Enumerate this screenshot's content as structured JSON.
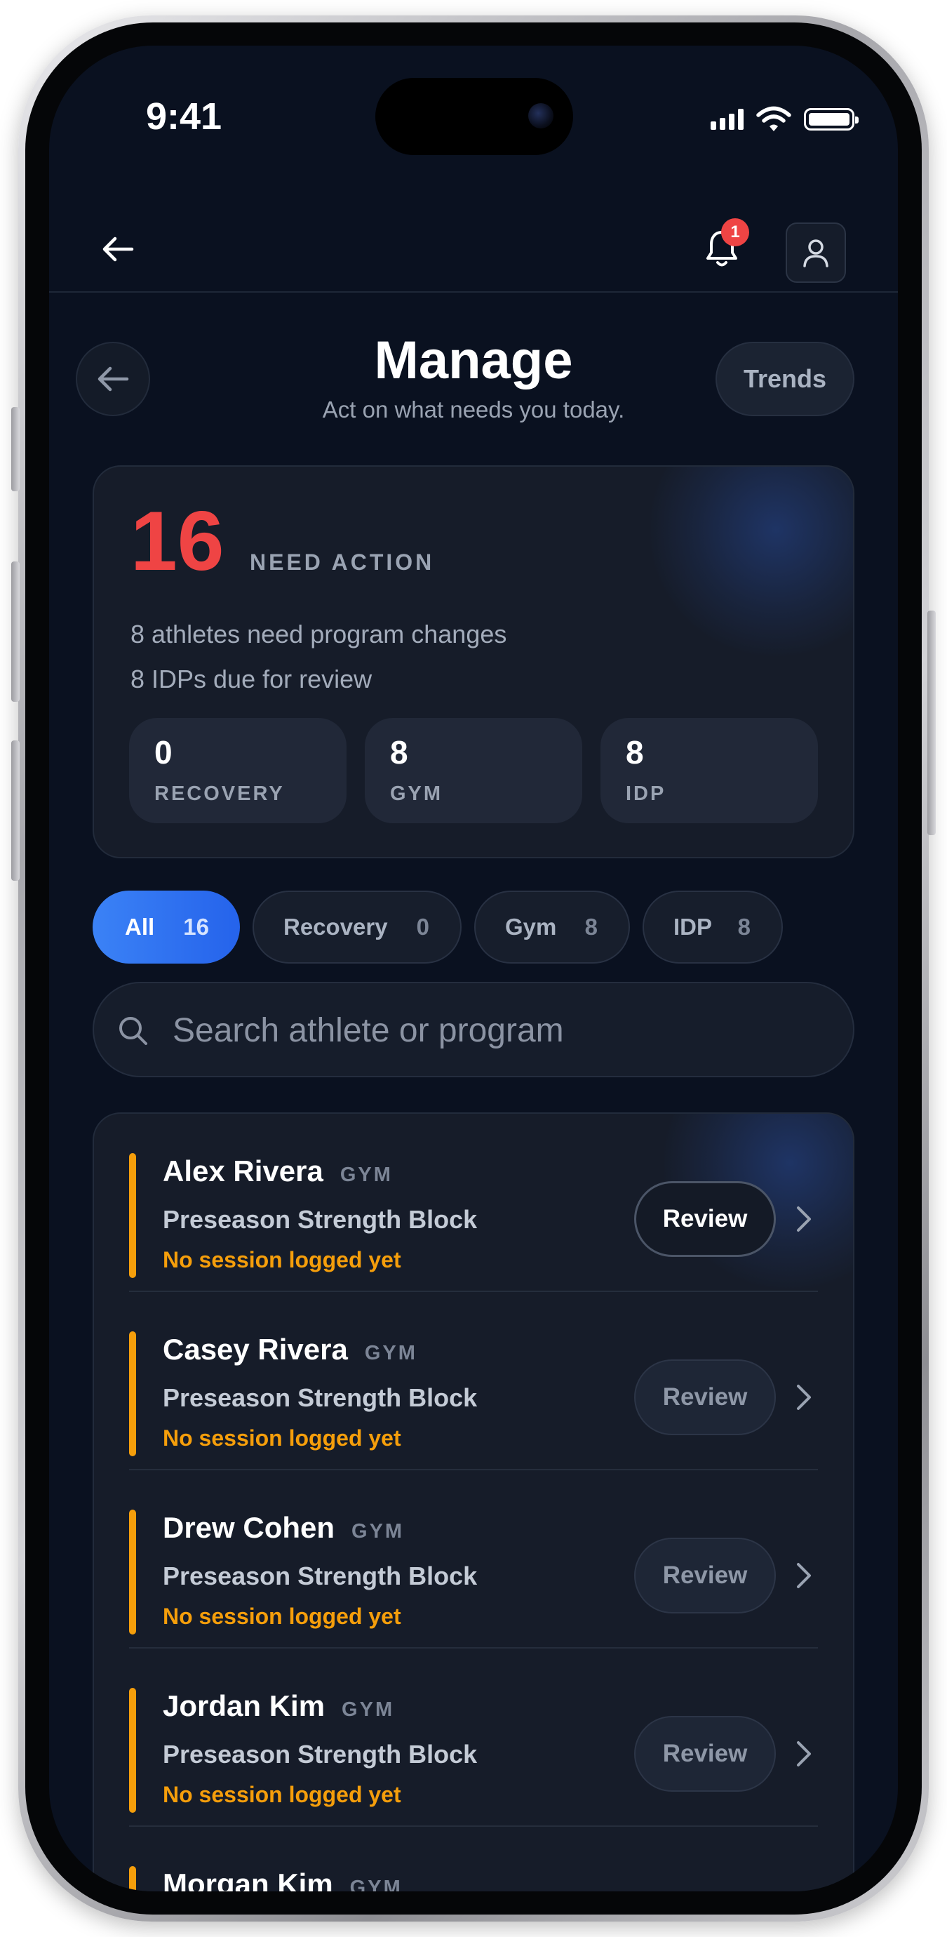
{
  "status_bar": {
    "time": "9:41"
  },
  "top_nav": {
    "notification_count": "1"
  },
  "header": {
    "title": "Manage",
    "subtitle": "Act on what needs you today.",
    "trends_label": "Trends"
  },
  "summary": {
    "count": "16",
    "count_label": "NEED ACTION",
    "line1": "8 athletes need program changes",
    "line2": "8 IDPs due for review",
    "stats": [
      {
        "value": "0",
        "label": "RECOVERY"
      },
      {
        "value": "8",
        "label": "GYM"
      },
      {
        "value": "8",
        "label": "IDP"
      }
    ]
  },
  "filters": [
    {
      "label": "All",
      "count": "16",
      "active": true
    },
    {
      "label": "Recovery",
      "count": "0",
      "active": false
    },
    {
      "label": "Gym",
      "count": "8",
      "active": false
    },
    {
      "label": "IDP",
      "count": "8",
      "active": false
    }
  ],
  "search": {
    "placeholder": "Search athlete or program"
  },
  "athletes": [
    {
      "name": "Alex Rivera",
      "tag": "GYM",
      "program": "Preseason Strength Block",
      "status": "No session logged yet",
      "action": "Review"
    },
    {
      "name": "Casey Rivera",
      "tag": "GYM",
      "program": "Preseason Strength Block",
      "status": "No session logged yet",
      "action": "Review"
    },
    {
      "name": "Drew Cohen",
      "tag": "GYM",
      "program": "Preseason Strength Block",
      "status": "No session logged yet",
      "action": "Review"
    },
    {
      "name": "Jordan Kim",
      "tag": "GYM",
      "program": "Preseason Strength Block",
      "status": "No session logged yet",
      "action": "Review"
    },
    {
      "name": "Morgan Kim",
      "tag": "GYM"
    }
  ],
  "colors": {
    "background": "#0a1120",
    "card": "#161c29",
    "accent": "#3b82f6",
    "alert": "#ef4444",
    "warning": "#f59e0b"
  },
  "icons": [
    "back-arrow-icon",
    "bell-icon",
    "user-icon",
    "search-icon",
    "chevron-right-icon",
    "signal-icon",
    "wifi-icon",
    "battery-icon"
  ]
}
